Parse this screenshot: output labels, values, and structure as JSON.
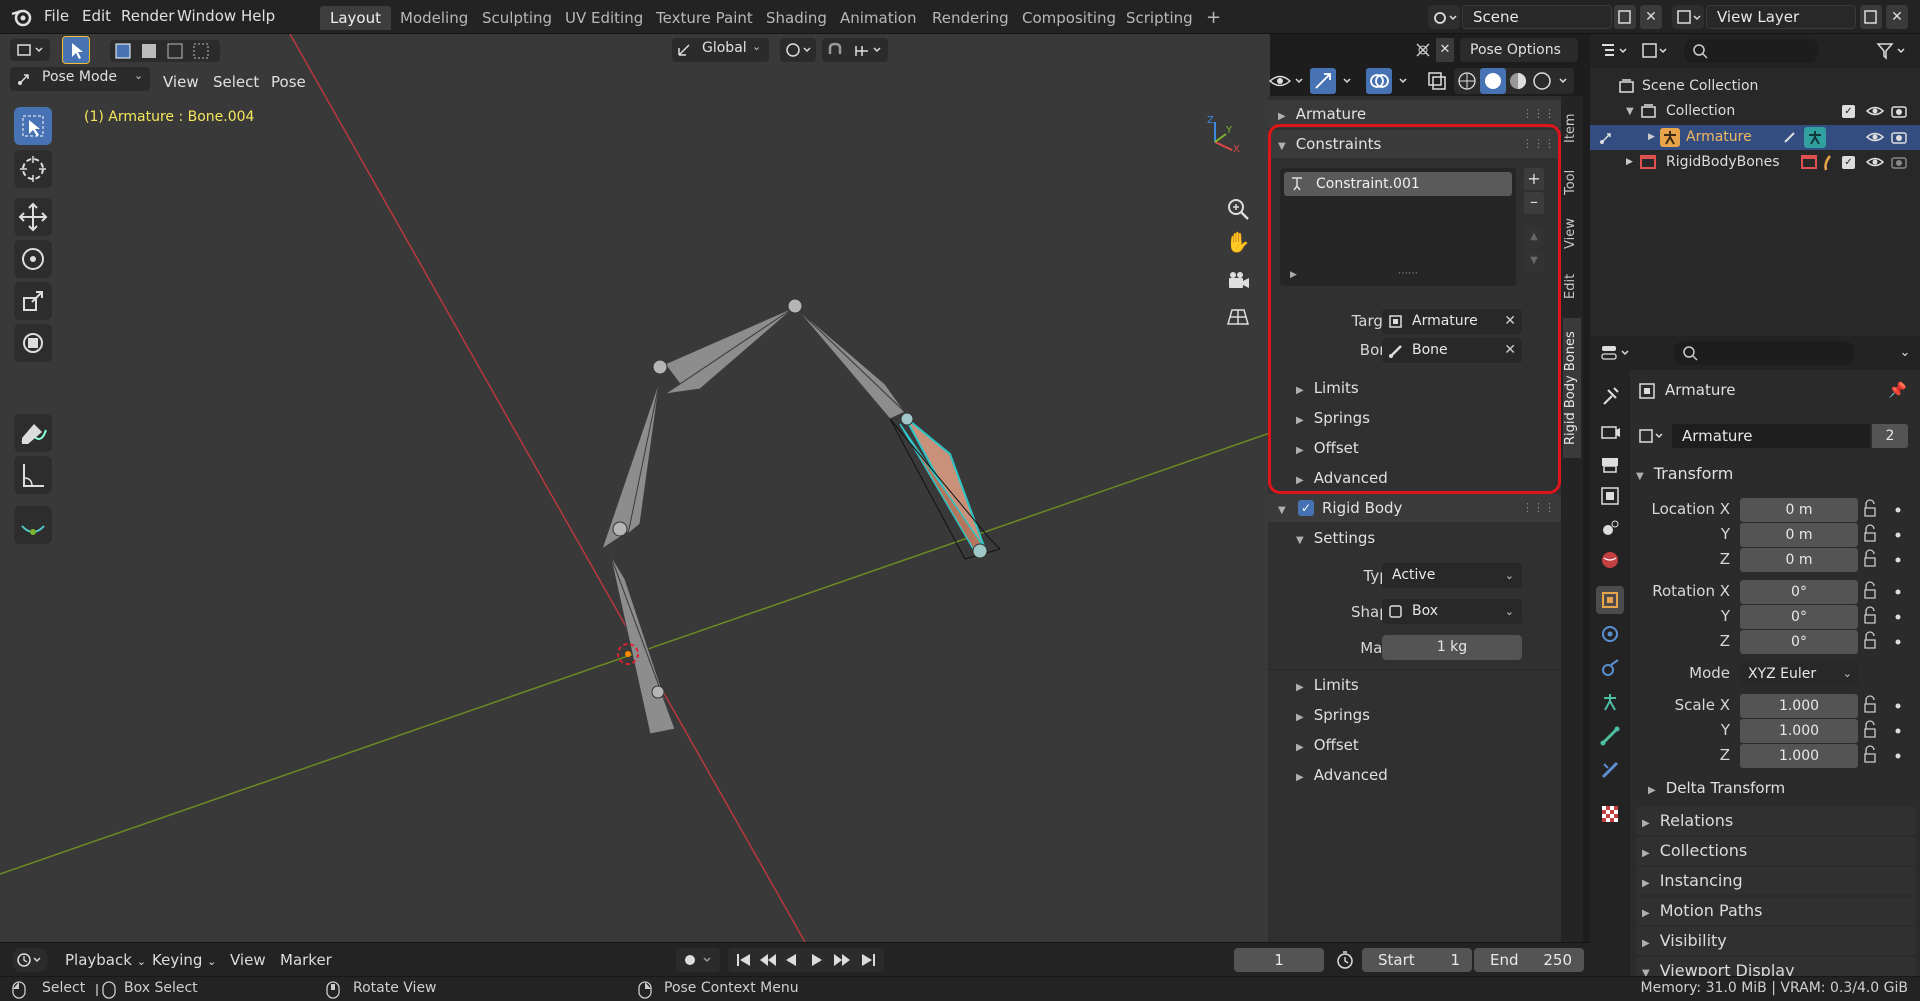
{
  "menubar": {
    "items": [
      "File",
      "Edit",
      "Render",
      "Window",
      "Help"
    ],
    "workspaces": [
      "Layout",
      "Modeling",
      "Sculpting",
      "UV Editing",
      "Texture Paint",
      "Shading",
      "Animation",
      "Rendering",
      "Compositing",
      "Scripting"
    ],
    "active_workspace": "Layout",
    "add_tab": "+",
    "scene": "Scene",
    "view_layer": "View Layer"
  },
  "viewport_header": {
    "mode": "Pose Mode",
    "menus": [
      "View",
      "Select",
      "Pose"
    ],
    "transform_orientation": "Global",
    "pose_options": "Pose Options"
  },
  "viewport": {
    "info_text": "(1) Armature : Bone.004",
    "axis_labels": {
      "x": "X",
      "y": "Y",
      "z": "Z"
    }
  },
  "npanel": {
    "armature_header": "Armature",
    "constraints": {
      "header": "Constraints",
      "list_item": "Constraint.001",
      "target_label": "Target",
      "target_value": "Armature",
      "bone_label": "Bone",
      "bone_value": "Bone",
      "subsections": [
        "Limits",
        "Springs",
        "Offset",
        "Advanced"
      ]
    },
    "rigid_body": {
      "header": "Rigid Body",
      "enabled": true,
      "settings_header": "Settings",
      "type_label": "Type",
      "type_value": "Active",
      "shape_label": "Shape",
      "shape_value": "Box",
      "mass_label": "Mass",
      "mass_value": "1 kg",
      "subsections": [
        "Limits",
        "Springs",
        "Offset",
        "Advanced"
      ]
    },
    "vertical_tabs": [
      "Item",
      "Tool",
      "View",
      "Edit",
      "Rigid Body Bones"
    ],
    "highlight_color": "#e0151b"
  },
  "outliner": {
    "scene_collection": "Scene Collection",
    "collection": "Collection",
    "armature": "Armature",
    "rigidbodybones": "RigidBodyBones"
  },
  "properties": {
    "object_name": "Armature",
    "datablock_name": "Armature",
    "datablock_users": "2",
    "transform_header": "Transform",
    "location_label": "Location X",
    "y_label": "Y",
    "z_label": "Z",
    "location": [
      "0 m",
      "0 m",
      "0 m"
    ],
    "rotation_label": "Rotation X",
    "rotation": [
      "0°",
      "0°",
      "0°"
    ],
    "mode_label": "Mode",
    "mode_value": "XYZ Euler",
    "scale_label": "Scale X",
    "scale": [
      "1.000",
      "1.000",
      "1.000"
    ],
    "delta_transform": "Delta Transform",
    "sections": [
      "Relations",
      "Collections",
      "Instancing",
      "Motion Paths",
      "Visibility",
      "Viewport Display"
    ]
  },
  "timeline": {
    "menus": [
      "Playback",
      "Keying",
      "View",
      "Marker"
    ],
    "current_frame": "1",
    "start_label": "Start",
    "start_value": "1",
    "end_label": "End",
    "end_value": "250"
  },
  "statusbar": {
    "select": "Select",
    "box_select": "Box Select",
    "rotate_view": "Rotate View",
    "context_menu": "Pose Context Menu",
    "memory": "Memory: 31.0 MiB | VRAM: 0.3/4.0 GiB"
  }
}
